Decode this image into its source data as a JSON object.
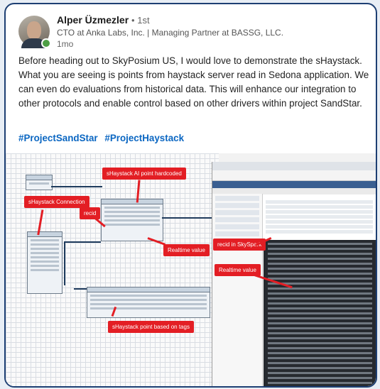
{
  "post": {
    "author": "Alper Üzmezler",
    "degree": "• 1st",
    "headline": "CTO at Anka Labs, Inc. | Managing Partner at BASSG, LLC.",
    "time": "1mo",
    "body": "Before heading out to SkyPosium US, I would love to demonstrate the sHaystack. What you are seeing is points from haystack server read in Sedona application. We can even do evaluations from historical data. This will enhance our integration to other protocols and enable control based on other drivers within project SandStar.",
    "hashtags": [
      "#ProjectSandStar",
      "#ProjectHaystack"
    ]
  },
  "screenshot": {
    "callouts": {
      "connection": "sHaystack Connection",
      "ai_point": "sHaystack AI point hardcoded",
      "recid": "recid",
      "realtime_left": "Realtime value",
      "tags": "sHaystack point based on tags",
      "recid_skyspark": "recid in SkySpark",
      "realtime_right": "Realtime value"
    }
  }
}
